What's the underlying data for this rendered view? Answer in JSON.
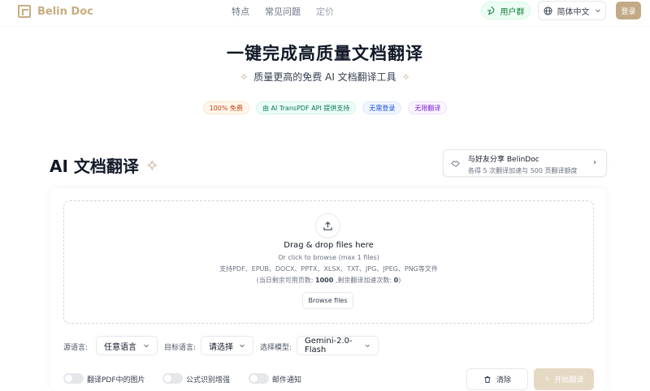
{
  "brand": {
    "name": "Belin Doc"
  },
  "nav": {
    "links": [
      "特点",
      "常见问题",
      "定价"
    ],
    "group_label": "用户群",
    "language": "简体中文",
    "login": "登录"
  },
  "hero": {
    "title": "一键完成高质量文档翻译",
    "subtitle": "质量更高的免费 AI 文档翻译工具"
  },
  "badges": [
    "100% 免费",
    "由 AI TransPDF API 提供支持",
    "无需登录",
    "无限翻译"
  ],
  "section": {
    "title": "AI 文档翻译"
  },
  "share": {
    "title": "与好友分享 BelinDoc",
    "subtitle": "各得 5 次翻译加速与 500 页翻译额度"
  },
  "dropzone": {
    "title": "Drag & drop files here",
    "hint": "Or click to browse (max 1 files)",
    "formats": "支持PDF、EPUB、DOCX、PPTX、XLSX、TXT、JPG、JPEG、PNG等文件",
    "quota_prefix": "(当日剩余可用页数: ",
    "pages_left": "1000",
    "quota_mid": " ,剩余翻译加速次数: ",
    "boosts_left": "0",
    "quota_suffix": ")",
    "browse_label": "Browse files"
  },
  "options": {
    "source_label": "源语言:",
    "source_value": "任意语言",
    "target_label": "目标语言:",
    "target_value": "请选择",
    "model_label": "选择模型:",
    "model_value": "Gemini-2.0-Flash"
  },
  "toggles": [
    {
      "label": "翻译PDF中的图片",
      "on": false
    },
    {
      "label": "公式识别增强",
      "on": false
    },
    {
      "label": "邮件通知",
      "on": false
    }
  ],
  "actions": {
    "clear": "清除",
    "start": "开始翻译"
  },
  "colors": {
    "brand": "#c3aa86",
    "start_disabled": "#e6d9c4",
    "group_green": "#15803d"
  }
}
